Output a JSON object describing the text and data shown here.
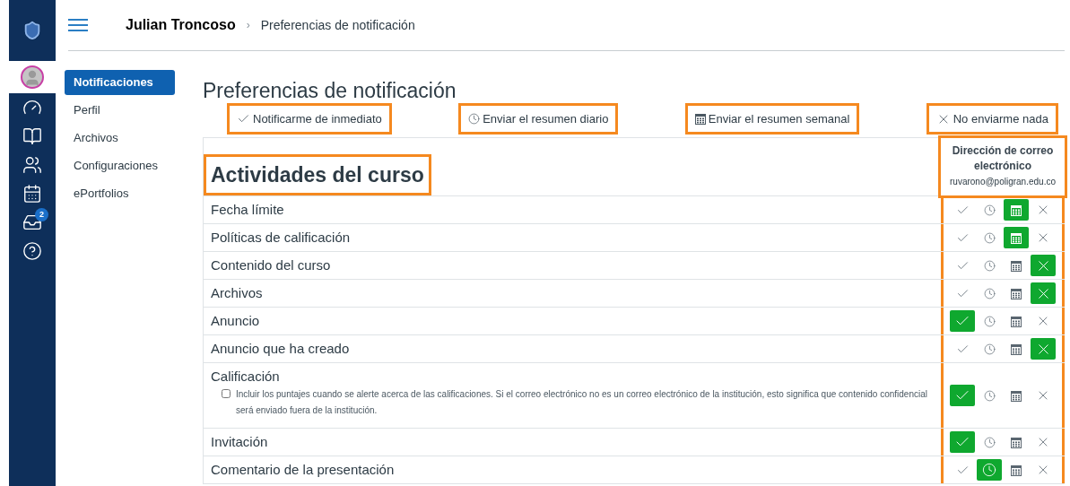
{
  "header": {
    "user": "Julian Troncoso",
    "separator": "›",
    "breadcrumb": "Preferencias de notificación"
  },
  "global_nav": [
    {
      "kind": "logo"
    },
    {
      "kind": "avatar",
      "selected": true
    },
    {
      "kind": "dashboard"
    },
    {
      "kind": "courses"
    },
    {
      "kind": "groups"
    },
    {
      "kind": "calendar"
    },
    {
      "kind": "inbox",
      "badge": "2"
    },
    {
      "kind": "help"
    }
  ],
  "side_nav": [
    {
      "label": "Notificaciones",
      "selected": true
    },
    {
      "label": "Perfil",
      "selected": false
    },
    {
      "label": "Archivos",
      "selected": false
    },
    {
      "label": "Configuraciones",
      "selected": false
    },
    {
      "label": "ePortfolios",
      "selected": false
    }
  ],
  "page_title": "Preferencias de notificación",
  "legend": [
    {
      "kind": "immediate",
      "label": "Notificarme de inmediato",
      "highlighted": true
    },
    {
      "kind": "daily",
      "label": "Enviar el resumen diario",
      "highlighted": true
    },
    {
      "kind": "weekly",
      "label": "Enviar el resumen semanal",
      "highlighted": true
    },
    {
      "kind": "never",
      "label": "No enviarme nada",
      "highlighted": true
    }
  ],
  "section": {
    "title": "Actividades del curso",
    "highlighted": true
  },
  "email_column": {
    "title": "Dirección de correo electrónico",
    "address": "ruvarono@poligran.edu.co",
    "highlighted": true
  },
  "rows": [
    {
      "name": "Fecha límite",
      "options": [
        {
          "kind": "immediate",
          "selected": false
        },
        {
          "kind": "daily",
          "selected": false
        },
        {
          "kind": "weekly",
          "selected": true
        },
        {
          "kind": "never",
          "selected": false
        }
      ]
    },
    {
      "name": "Políticas de calificación",
      "options": [
        {
          "kind": "immediate",
          "selected": false
        },
        {
          "kind": "daily",
          "selected": false
        },
        {
          "kind": "weekly",
          "selected": true
        },
        {
          "kind": "never",
          "selected": false
        }
      ]
    },
    {
      "name": "Contenido del curso",
      "options": [
        {
          "kind": "immediate",
          "selected": false
        },
        {
          "kind": "daily",
          "selected": false
        },
        {
          "kind": "weekly",
          "selected": false
        },
        {
          "kind": "never",
          "selected": true
        }
      ]
    },
    {
      "name": "Archivos",
      "options": [
        {
          "kind": "immediate",
          "selected": false
        },
        {
          "kind": "daily",
          "selected": false
        },
        {
          "kind": "weekly",
          "selected": false
        },
        {
          "kind": "never",
          "selected": true
        }
      ]
    },
    {
      "name": "Anuncio",
      "options": [
        {
          "kind": "immediate",
          "selected": true
        },
        {
          "kind": "daily",
          "selected": false
        },
        {
          "kind": "weekly",
          "selected": false
        },
        {
          "kind": "never",
          "selected": false
        }
      ]
    },
    {
      "name": "Anuncio que ha creado",
      "options": [
        {
          "kind": "immediate",
          "selected": false
        },
        {
          "kind": "daily",
          "selected": false
        },
        {
          "kind": "weekly",
          "selected": false
        },
        {
          "kind": "never",
          "selected": true
        }
      ]
    },
    {
      "name": "Calificación",
      "options": [
        {
          "kind": "immediate",
          "selected": true
        },
        {
          "kind": "daily",
          "selected": false
        },
        {
          "kind": "weekly",
          "selected": false
        },
        {
          "kind": "never",
          "selected": false
        }
      ],
      "option": {
        "label": "Incluir los puntajes cuando se alerte acerca de las calificaciones. Si el correo electrónico no es un correo electrónico de la institución, esto significa que contenido confidencial será enviado fuera de la institución.",
        "checked": false
      }
    },
    {
      "name": "Invitación",
      "options": [
        {
          "kind": "immediate",
          "selected": true
        },
        {
          "kind": "daily",
          "selected": false
        },
        {
          "kind": "weekly",
          "selected": false
        },
        {
          "kind": "never",
          "selected": false
        }
      ]
    },
    {
      "name": "Comentario de la presentación",
      "options": [
        {
          "kind": "immediate",
          "selected": false
        },
        {
          "kind": "daily",
          "selected": true
        },
        {
          "kind": "weekly",
          "selected": false
        },
        {
          "kind": "never",
          "selected": false
        }
      ]
    }
  ]
}
